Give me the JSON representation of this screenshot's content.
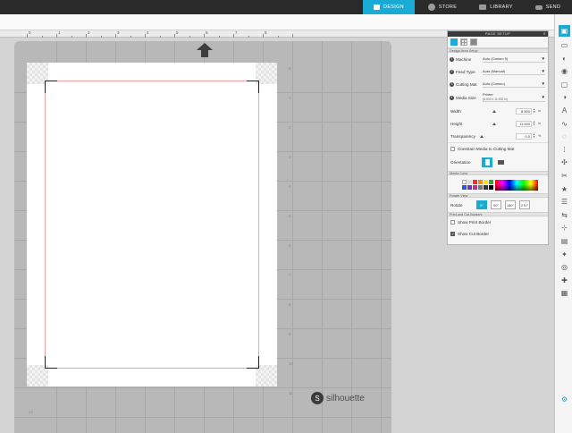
{
  "nav": {
    "tabs": [
      {
        "label": "DESIGN",
        "active": true,
        "icon": "monitor-icon"
      },
      {
        "label": "STORE",
        "active": false,
        "icon": "silhouette-s-icon"
      },
      {
        "label": "LIBRARY",
        "active": false,
        "icon": "library-icon"
      },
      {
        "label": "SEND",
        "active": false,
        "icon": "send-icon"
      }
    ]
  },
  "ruler": {
    "numbers": [
      "0",
      "1",
      "2",
      "3",
      "4",
      "5",
      "6",
      "7",
      "8"
    ]
  },
  "mat": {
    "row_numbers": [
      "0",
      "1",
      "2",
      "3",
      "4",
      "5",
      "6",
      "7",
      "8",
      "9",
      "10",
      "11"
    ],
    "bottom_label": "12"
  },
  "logo": {
    "glyph": "S",
    "text": "silhouette"
  },
  "panel": {
    "title": "PAGE SETUP",
    "close_glyph": "✕",
    "sections": {
      "design_area": "Design Area Setup",
      "media_color": "Media Color",
      "rotate_view": "Rotate View",
      "print_cut": "Print and Cut Borders"
    },
    "machine": {
      "num": "1",
      "label": "Machine",
      "value": "Auto (Cameo 5)"
    },
    "feed_type": {
      "num": "2",
      "label": "Feed Type",
      "value": "Auto (Manual)"
    },
    "cutting_mat": {
      "num": "3",
      "label": "Cutting Mat",
      "value": "Auto (Cameo)"
    },
    "media_size": {
      "num": "4",
      "label": "Media Size",
      "value": "Printer",
      "sub": "(8.500 x 11.000 in)"
    },
    "width": {
      "label": "Width",
      "value": "8.500",
      "unit": "in"
    },
    "height": {
      "label": "Height",
      "value": "11.000",
      "unit": "in"
    },
    "transparency": {
      "label": "Transparency",
      "value": "0.0",
      "unit": "%"
    },
    "constrain_label": "Constrain Media to Cutting Mat",
    "orientation_label": "Orientation",
    "rotate_label": "Rotate",
    "show_print_border": "Show Print Border",
    "show_cut_border": "Show Cut Border",
    "rotate_options": [
      "0°",
      "90°",
      "180°",
      "270°"
    ],
    "swatches": [
      "#ffffff",
      "#dddddd",
      "#ff2a2a",
      "#ff8a00",
      "#ffe100",
      "#2aa830",
      "#2458d6",
      "#7a2cc4",
      "#c72aa0",
      "#777777",
      "#333333",
      "#000000"
    ]
  },
  "rail": {
    "icons": [
      "page-setup-icon",
      "library-panel-icon",
      "fill-icon",
      "line-icon",
      "shadow-icon",
      "transparency-icon",
      "text-icon",
      "sketch-icon",
      "offset-icon",
      "replicate-icon",
      "trace-icon",
      "knife-icon",
      "modify-icon",
      "align-icon",
      "transform-icon",
      "point-icon",
      "layers-icon",
      "rhinestone-icon",
      "emboss-icon",
      "puzzle-icon",
      "layout-icon",
      "gear-icon"
    ]
  }
}
